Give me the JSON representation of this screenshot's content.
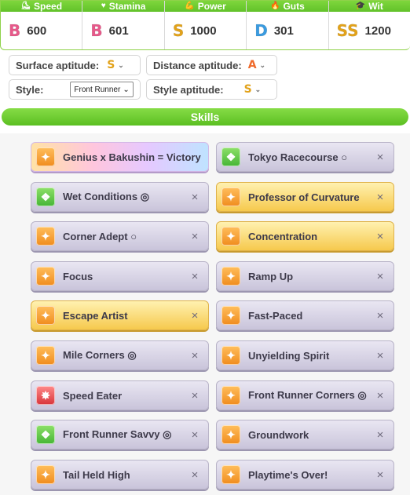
{
  "stats": [
    {
      "label": "Speed",
      "icon": "shoe-icon",
      "grade": "B",
      "grade_color": "#e7598a",
      "value": "600"
    },
    {
      "label": "Stamina",
      "icon": "heart-icon",
      "grade": "B",
      "grade_color": "#e7598a",
      "value": "601"
    },
    {
      "label": "Power",
      "icon": "muscle-icon",
      "grade": "S",
      "grade_color": "#e2a21a",
      "value": "1000"
    },
    {
      "label": "Guts",
      "icon": "flame-icon",
      "grade": "D",
      "grade_color": "#3a9be0",
      "value": "301"
    },
    {
      "label": "Wit",
      "icon": "cap-icon",
      "grade": "SS",
      "grade_color": "#e2a21a",
      "value": "1200"
    }
  ],
  "aptitudes": {
    "surface_label": "Surface aptitude:",
    "surface_value": "S",
    "distance_label": "Distance aptitude:",
    "distance_value": "A",
    "distance_color": "#ef6a2b",
    "style_label": "Style:",
    "style_value": "Front Runner",
    "style_aptitude_label": "Style aptitude:",
    "style_aptitude_value": "S",
    "s_color": "#e2a21a"
  },
  "skills_header": "Skills",
  "skills": [
    {
      "name": "Genius x Bakushin = Victory",
      "rarity": "rainbow",
      "icon": "orange"
    },
    {
      "name": "Tokyo Racecourse ○",
      "rarity": "normal",
      "icon": "green"
    },
    {
      "name": "Wet Conditions ◎",
      "rarity": "normal",
      "icon": "green"
    },
    {
      "name": "Professor of Curvature",
      "rarity": "gold",
      "icon": "orange"
    },
    {
      "name": "Corner Adept ○",
      "rarity": "normal",
      "icon": "orange"
    },
    {
      "name": "Concentration",
      "rarity": "gold",
      "icon": "orange"
    },
    {
      "name": "Focus",
      "rarity": "normal",
      "icon": "orange"
    },
    {
      "name": "Ramp Up",
      "rarity": "normal",
      "icon": "orange"
    },
    {
      "name": "Escape Artist",
      "rarity": "gold",
      "icon": "orange"
    },
    {
      "name": "Fast-Paced",
      "rarity": "normal",
      "icon": "orange"
    },
    {
      "name": "Mile Corners ◎",
      "rarity": "normal",
      "icon": "orange"
    },
    {
      "name": "Unyielding Spirit",
      "rarity": "normal",
      "icon": "orange"
    },
    {
      "name": "Speed Eater",
      "rarity": "normal",
      "icon": "red"
    },
    {
      "name": "Front Runner Corners ◎",
      "rarity": "normal",
      "icon": "orange"
    },
    {
      "name": "Front Runner Savvy ◎",
      "rarity": "normal",
      "icon": "green"
    },
    {
      "name": "Groundwork",
      "rarity": "normal",
      "icon": "orange"
    },
    {
      "name": "Tail Held High",
      "rarity": "normal",
      "icon": "orange"
    },
    {
      "name": "Playtime's Over!",
      "rarity": "normal",
      "icon": "orange"
    }
  ],
  "close_glyph": "×"
}
